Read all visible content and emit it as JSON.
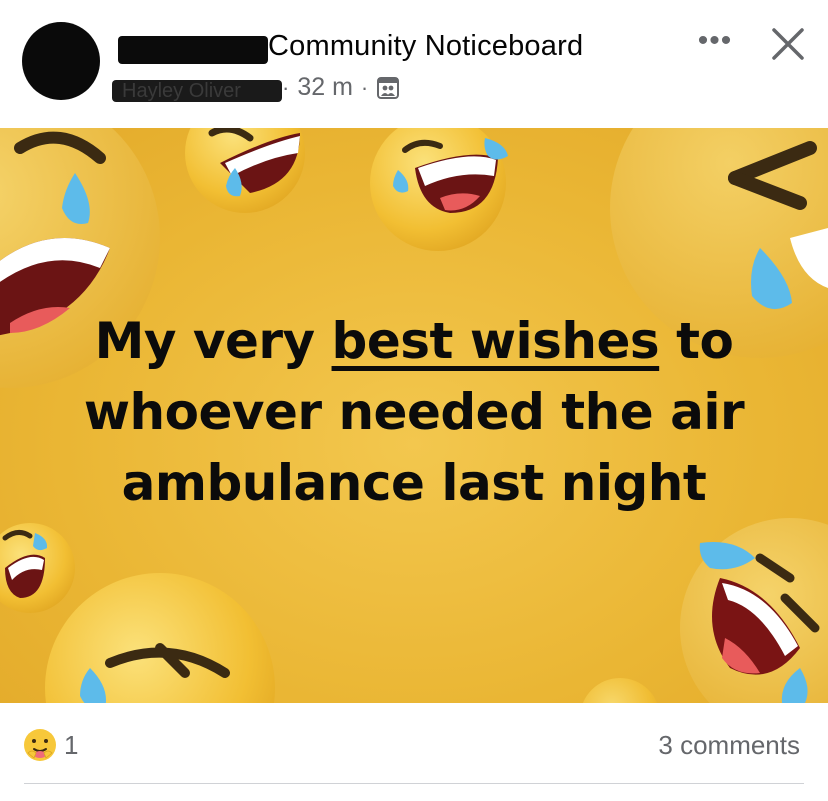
{
  "post": {
    "group_name": "Community Noticeboard",
    "author_name": "Hayley Oliver",
    "time_ago": "32 m",
    "separator": "·",
    "audience_icon": "group-audience-icon"
  },
  "header_actions": {
    "more_icon": "more-options-icon",
    "more_glyph": "•••",
    "close_icon": "close-icon"
  },
  "image_text": {
    "line1_before": "My very ",
    "line1_underlined": "best wishes",
    "line1_after": " to",
    "line2": "whoever needed the air",
    "line3": "ambulance last night"
  },
  "footer": {
    "reaction_icon": "care-reaction-icon",
    "reaction_count": "1",
    "comments": "3 comments"
  },
  "colors": {
    "image_background": "#EAB634",
    "emoji_yellow": "#F7C83A",
    "tear_blue": "#5DBBEA",
    "secondary_text": "#65676B"
  }
}
